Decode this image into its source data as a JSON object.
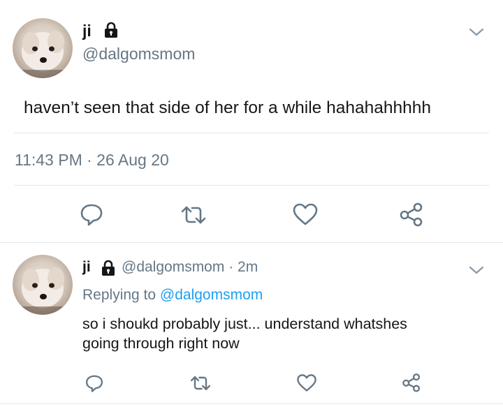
{
  "tweet": {
    "display_name": "ji",
    "handle": "@dalgomsmom",
    "text": "haven’t seen that side of her for a while hahahahhhhh",
    "timestamp": "11:43 PM · 26 Aug 20",
    "icons": {
      "protected": "lock-icon",
      "more": "chevron-down-icon",
      "actions": [
        "reply-icon",
        "retweet-icon",
        "like-icon",
        "share-icon"
      ]
    }
  },
  "reply": {
    "display_name": "ji",
    "handle": "@dalgomsmom",
    "separator": "·",
    "age": "2m",
    "replying_prefix": "Replying to",
    "replying_handle": "@dalgomsmom",
    "text_line1": "so i shoukd probably just... understand whatshes",
    "text_line2": "going through right now"
  },
  "colors": {
    "muted": "#657786",
    "link": "#1da1f2",
    "divider": "#e1e8ed",
    "icon": "#657786"
  }
}
